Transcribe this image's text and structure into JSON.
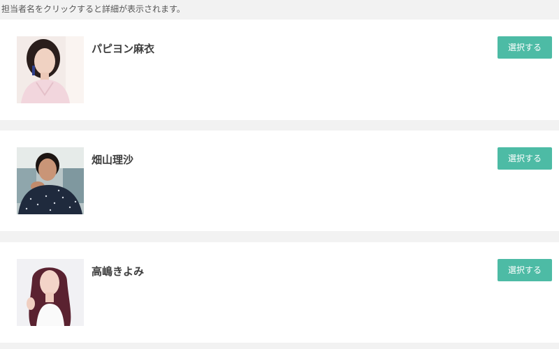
{
  "instruction": "担当者名をクリックすると詳細が表示されます。",
  "staff": [
    {
      "name": "パピヨン麻衣",
      "button_label": "選択する"
    },
    {
      "name": "畑山理沙",
      "button_label": "選択する"
    },
    {
      "name": "高嶋きよみ",
      "button_label": "選択する"
    }
  ],
  "colors": {
    "page_background": "#f2f2f2",
    "card_background": "#ffffff",
    "button": "#4dbba5",
    "button_text": "#ffffff",
    "name_text": "#3d3d3d"
  }
}
